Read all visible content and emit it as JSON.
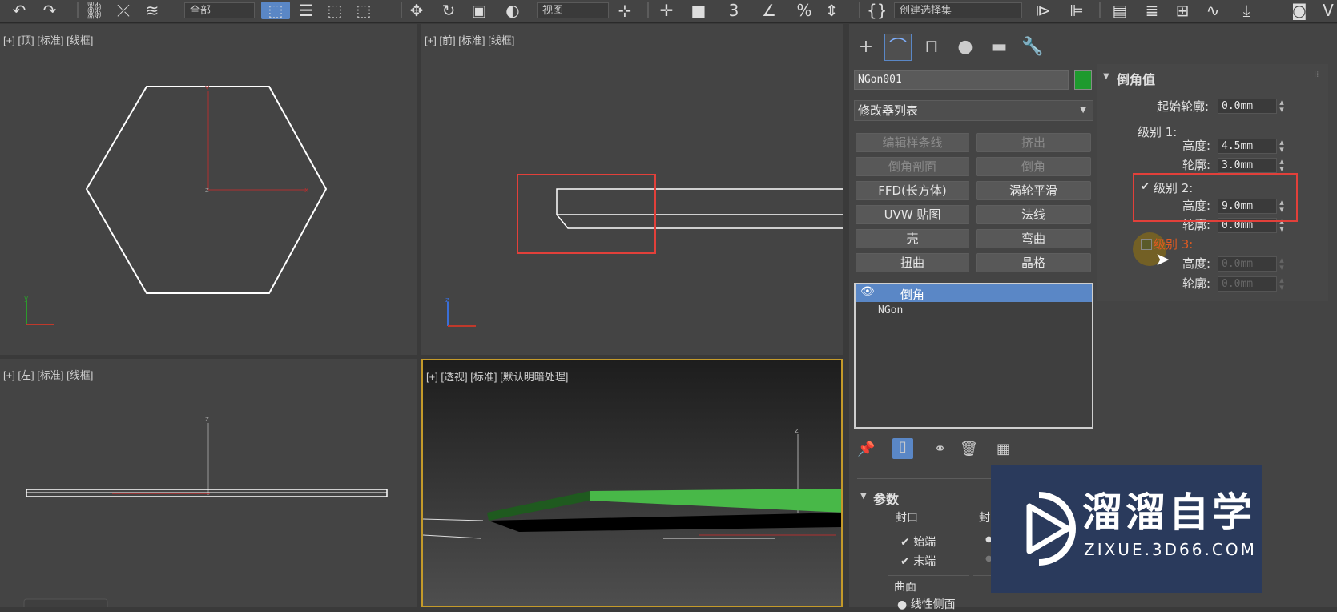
{
  "toolbar": {
    "selection_filter": "全部",
    "ref_coord": "视图",
    "named_selection": "创建选择集"
  },
  "viewports": {
    "top_label": "[+] [顶] [标准] [线框]",
    "front_label": "[+] [前] [标准] [线框]",
    "left_label": "[+] [左] [标准] [线框]",
    "persp_label": "[+] [透视] [标准] [默认明暗处理]"
  },
  "axis_letters": {
    "x": "x",
    "y": "y",
    "z": "z"
  },
  "command_panel": {
    "tabs": [
      "create-icon",
      "modify-icon",
      "hierarchy-icon",
      "motion-icon",
      "display-icon",
      "utilities-icon"
    ],
    "object_name": "NGon001",
    "object_color": "#1e9a2e",
    "modifier_list": "修改器列表",
    "modifier_buttons": [
      {
        "label": "编辑样条线",
        "enabled": false
      },
      {
        "label": "挤出",
        "enabled": false
      },
      {
        "label": "倒角剖面",
        "enabled": false
      },
      {
        "label": "倒角",
        "enabled": false
      },
      {
        "label": "FFD(长方体)",
        "enabled": true
      },
      {
        "label": "涡轮平滑",
        "enabled": true
      },
      {
        "label": "UVW 贴图",
        "enabled": true
      },
      {
        "label": "法线",
        "enabled": true
      },
      {
        "label": "壳",
        "enabled": true
      },
      {
        "label": "弯曲",
        "enabled": true
      },
      {
        "label": "扭曲",
        "enabled": true
      },
      {
        "label": "晶格",
        "enabled": true
      }
    ],
    "stack": [
      {
        "label": "倒角",
        "selected": true
      },
      {
        "label": "NGon",
        "selected": false
      }
    ]
  },
  "bevel_values": {
    "title": "倒角值",
    "start_outline_label": "起始轮廓:",
    "start_outline": "0.0mm",
    "level1_label": "级别 1:",
    "height_label": "高度:",
    "outline_label": "轮廓:",
    "level1_height": "4.5mm",
    "level1_outline": "3.0mm",
    "level2_label": "级别 2:",
    "level2_checked": true,
    "level2_height": "9.0mm",
    "level2_outline": "0.0mm",
    "level3_label": "级别 3:",
    "level3_checked": false,
    "level3_height": "0.0mm",
    "level3_outline": "0.0mm"
  },
  "parameters": {
    "title": "参数",
    "capping_label": "封口",
    "start_label": "始端",
    "end_label": "末端",
    "cap_type_label": "封",
    "surface_label": "曲面",
    "linear_sides_label": "线性侧面"
  },
  "watermark": {
    "brand_cn": "溜溜自学",
    "brand_url": "ZIXUE.3D66.COM"
  }
}
